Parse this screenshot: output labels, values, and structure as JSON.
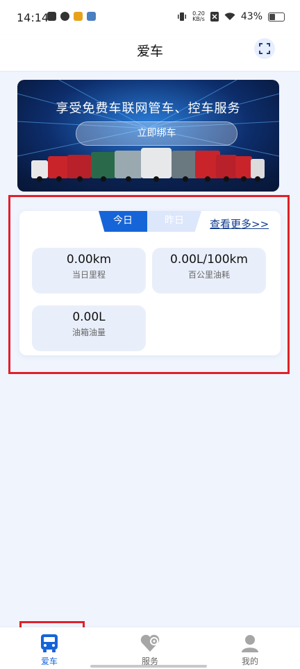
{
  "status_bar": {
    "time": "14:14",
    "speed_value": "0.20",
    "speed_unit": "KB/s",
    "battery": "43%"
  },
  "header": {
    "title": "爱车"
  },
  "banner": {
    "title": "享受免费车联网管车、控车服务",
    "bind_button": "立即绑车"
  },
  "stats": {
    "tabs": [
      "今日",
      "昨日"
    ],
    "more_link": "查看更多>>",
    "items": [
      {
        "value": "0.00km",
        "label": "当日里程"
      },
      {
        "value": "0.00L/100km",
        "label": "百公里油耗"
      },
      {
        "value": "0.00L",
        "label": "油箱油量"
      }
    ]
  },
  "tabbar": {
    "items": [
      {
        "label": "爱车",
        "icon": "bus-icon",
        "active": true
      },
      {
        "label": "服务",
        "icon": "location-heart-icon",
        "active": false
      },
      {
        "label": "我的",
        "icon": "user-icon",
        "active": false
      }
    ]
  },
  "colors": {
    "accent": "#1565d8",
    "highlight": "#e0202a",
    "inactive": "#9a9a9a"
  }
}
